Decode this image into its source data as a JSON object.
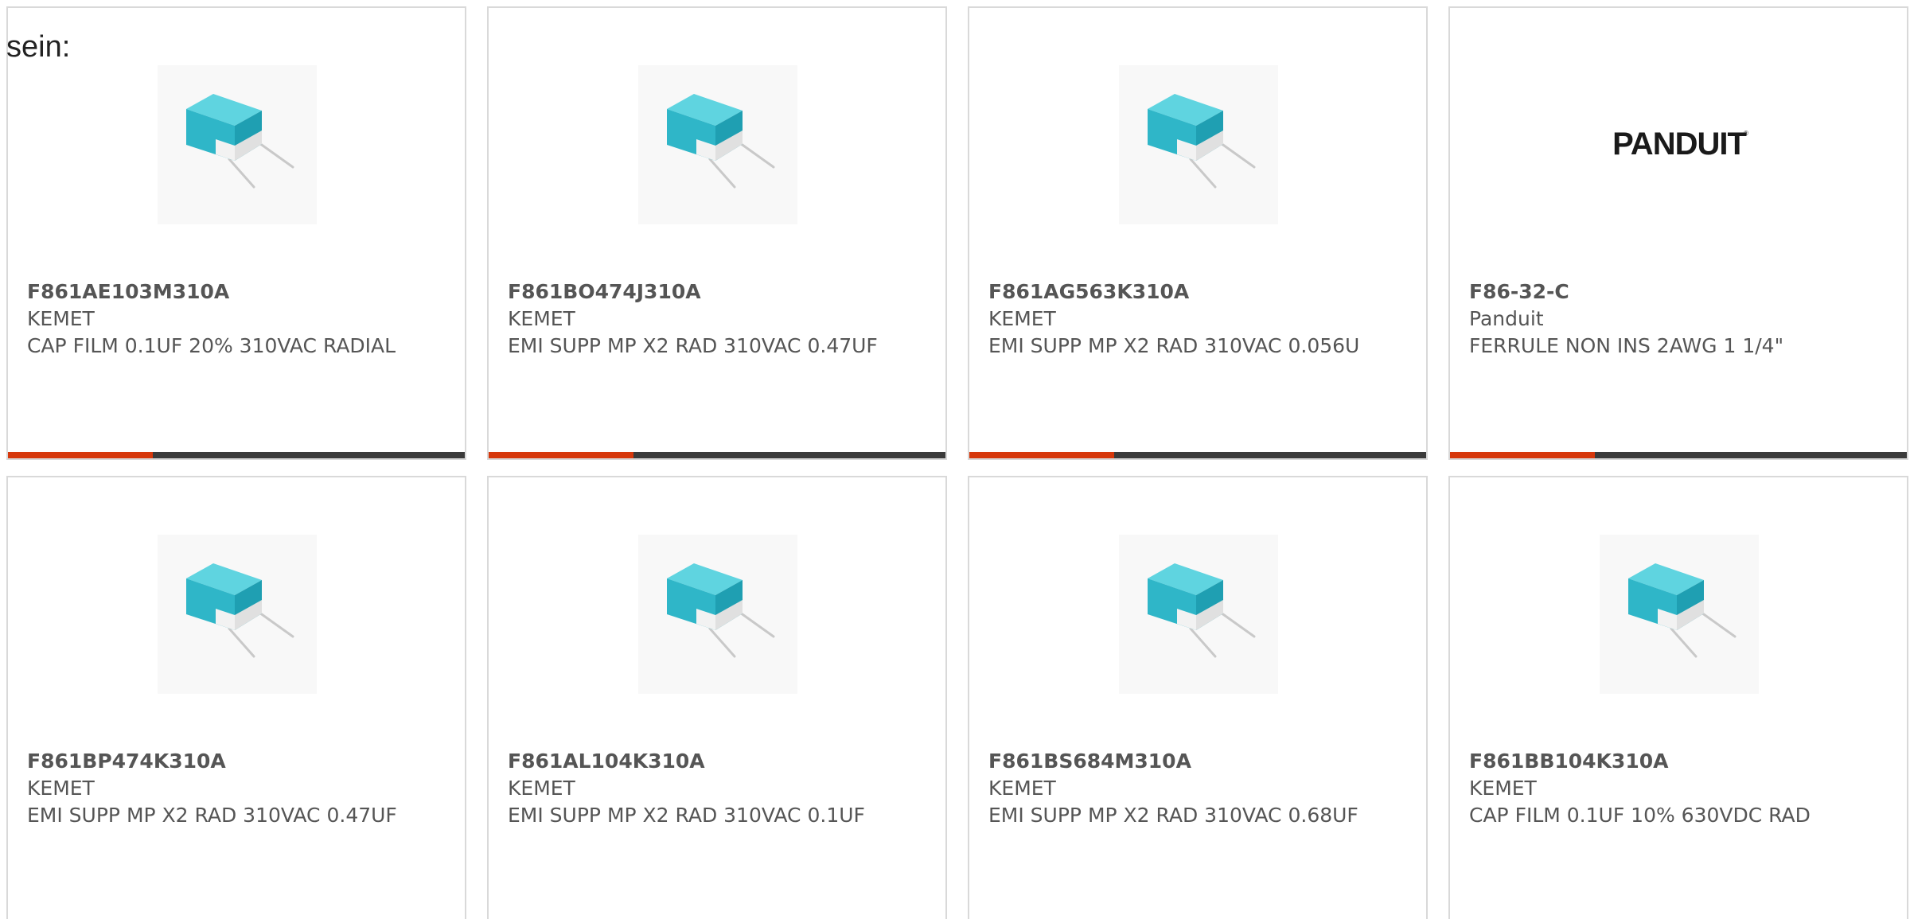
{
  "intro_text": "sein:",
  "colors": {
    "accent": "#d6380c",
    "bar": "#3b3b3b",
    "border": "#d9d9d9",
    "text": "#555555",
    "capacitor": "#3cc0d0"
  },
  "products": [
    {
      "part_number": "F861AE103M310A",
      "manufacturer": "KEMET",
      "description": "CAP FILM 0.1UF 20% 310VAC RADIAL",
      "image": "film-capacitor-icon"
    },
    {
      "part_number": "F861BO474J310A",
      "manufacturer": "KEMET",
      "description": "EMI SUPP MP X2 RAD 310VAC 0.47UF",
      "image": "film-capacitor-icon"
    },
    {
      "part_number": "F861AG563K310A",
      "manufacturer": "KEMET",
      "description": "EMI SUPP MP X2 RAD 310VAC 0.056U",
      "image": "film-capacitor-icon"
    },
    {
      "part_number": "F86-32-C",
      "manufacturer": "Panduit",
      "description": "FERRULE NON INS 2AWG 1 1/4\"",
      "image": "panduit-logo",
      "logo_text": "PANDUIT"
    },
    {
      "part_number": "F861BP474K310A",
      "manufacturer": "KEMET",
      "description": "EMI SUPP MP X2 RAD 310VAC 0.47UF",
      "image": "film-capacitor-icon"
    },
    {
      "part_number": "F861AL104K310A",
      "manufacturer": "KEMET",
      "description": "EMI SUPP MP X2 RAD 310VAC 0.1UF",
      "image": "film-capacitor-icon"
    },
    {
      "part_number": "F861BS684M310A",
      "manufacturer": "KEMET",
      "description": "EMI SUPP MP X2 RAD 310VAC 0.68UF",
      "image": "film-capacitor-icon"
    },
    {
      "part_number": "F861BB104K310A",
      "manufacturer": "KEMET",
      "description": "CAP FILM 0.1UF 10% 630VDC RAD",
      "image": "film-capacitor-icon"
    }
  ]
}
